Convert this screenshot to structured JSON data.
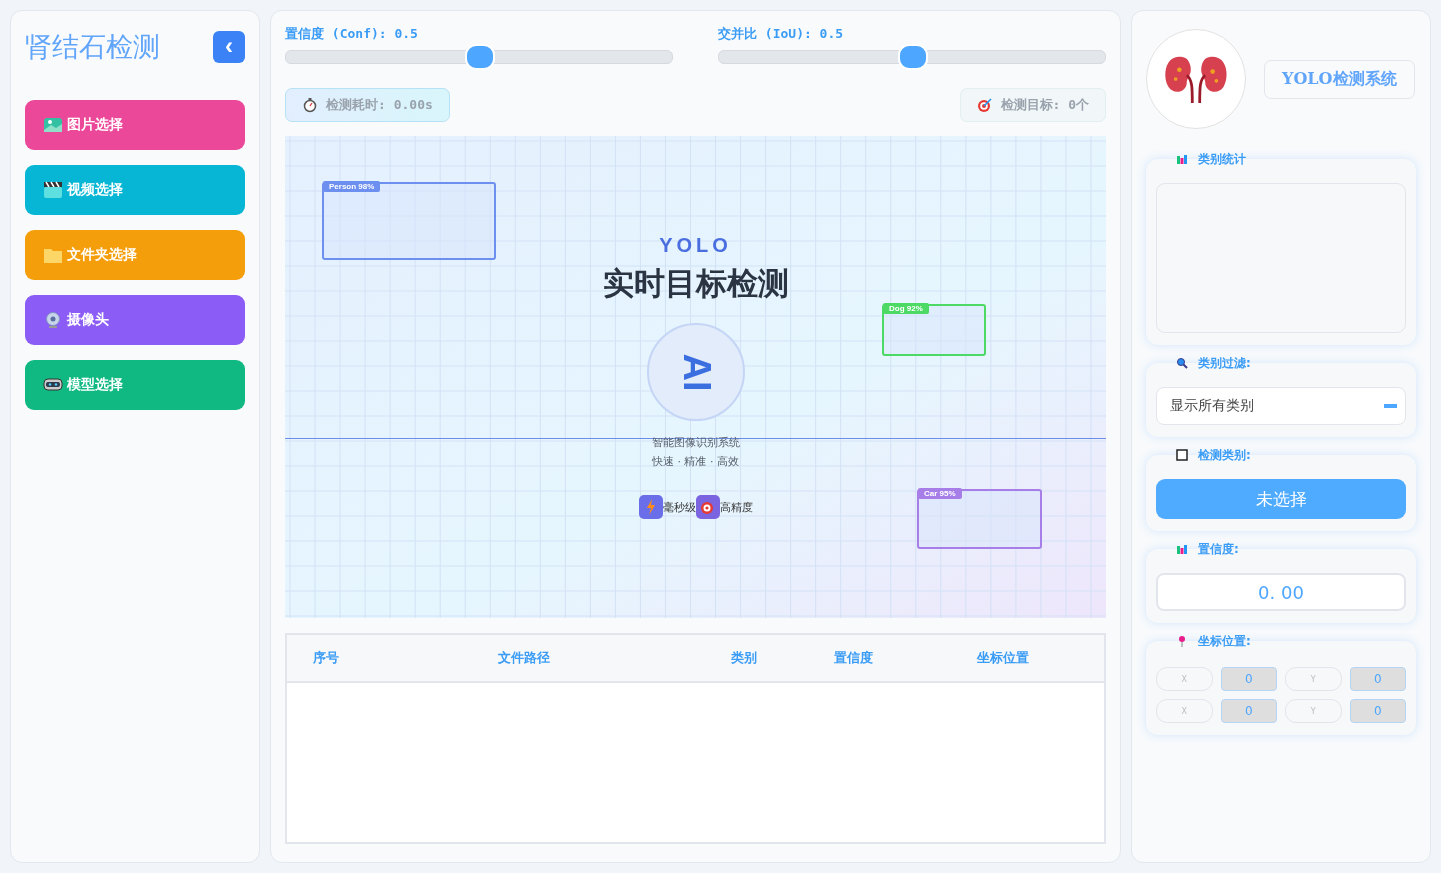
{
  "sidebar": {
    "title": "肾结石检测",
    "collapse_icon": "‹",
    "buttons": [
      {
        "label": "图片选择",
        "kind": "image",
        "color": "#ec4899"
      },
      {
        "label": "视频选择",
        "kind": "video",
        "color": "#06b6d4"
      },
      {
        "label": "文件夹选择",
        "kind": "folder",
        "color": "#f59e0b"
      },
      {
        "label": "摄像头",
        "kind": "camera",
        "color": "#8b5cf6"
      },
      {
        "label": "模型选择",
        "kind": "model",
        "color": "#10b981"
      }
    ]
  },
  "sliders": [
    {
      "label": "置信度 (Conf):",
      "reading": "0.5",
      "level": 0.5
    },
    {
      "label": "交并比 (IoU):",
      "reading": "0.5",
      "level": 0.5
    }
  ],
  "stats": [
    {
      "kind": "time",
      "label": "检测耗时:",
      "value": "0.00s"
    },
    {
      "kind": "target",
      "label": "检测目标:",
      "value": "0个"
    }
  ],
  "preview": {
    "brand": "YOLO",
    "title": "实时目标检测",
    "badge": "AI",
    "subtitle": "智能图像识别系统",
    "tagline": "快速 · 精准 · 高效",
    "features": [
      {
        "kind": "bolt",
        "label": "毫秒级"
      },
      {
        "kind": "target",
        "label": "高精度"
      }
    ],
    "boxes": [
      {
        "label": "Person 98%",
        "color": "#6d8ff0",
        "kind": "a"
      },
      {
        "label": "Dog 92%",
        "color": "#4cd964",
        "kind": "b"
      },
      {
        "label": "Car 95%",
        "color": "#a77ee8",
        "kind": "c"
      }
    ]
  },
  "table": {
    "columns": [
      "序号",
      "文件路径",
      "类别",
      "置信度",
      "坐标位置"
    ]
  },
  "right": {
    "system_title": "YOLO检测系统",
    "sections": [
      {
        "kind": "stats",
        "title": "类别统计"
      },
      {
        "kind": "filter",
        "title": "类别过滤:",
        "value": "显示所有类别"
      },
      {
        "kind": "class",
        "title": "检测类别:",
        "value": "未选择"
      },
      {
        "kind": "conf",
        "title": "置信度:",
        "value": "0. 00"
      },
      {
        "kind": "coords",
        "title": "坐标位置:",
        "cells": [
          {
            "label": "X",
            "value": "0"
          },
          {
            "label": "Y",
            "value": "0"
          },
          {
            "label": "X",
            "value": "0"
          },
          {
            "label": "Y",
            "value": "0"
          }
        ]
      }
    ]
  }
}
